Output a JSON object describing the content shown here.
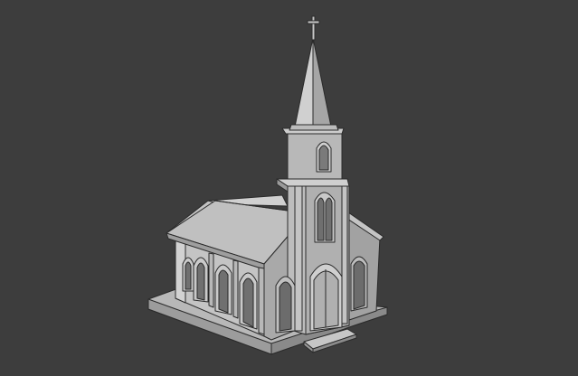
{
  "viewport": {
    "background": "#3d3d3d",
    "object": "church-model",
    "shading": "solid-grey-wireframe"
  },
  "colors": {
    "wall_light": "#c6c6c6",
    "wall_mid": "#b2b2b2",
    "wall_dark": "#8e8e8e",
    "roof": "#bdbdbd",
    "roof_shade": "#a8a8a8",
    "edge": "#2a2a2a",
    "window": "#6f6f6f"
  }
}
